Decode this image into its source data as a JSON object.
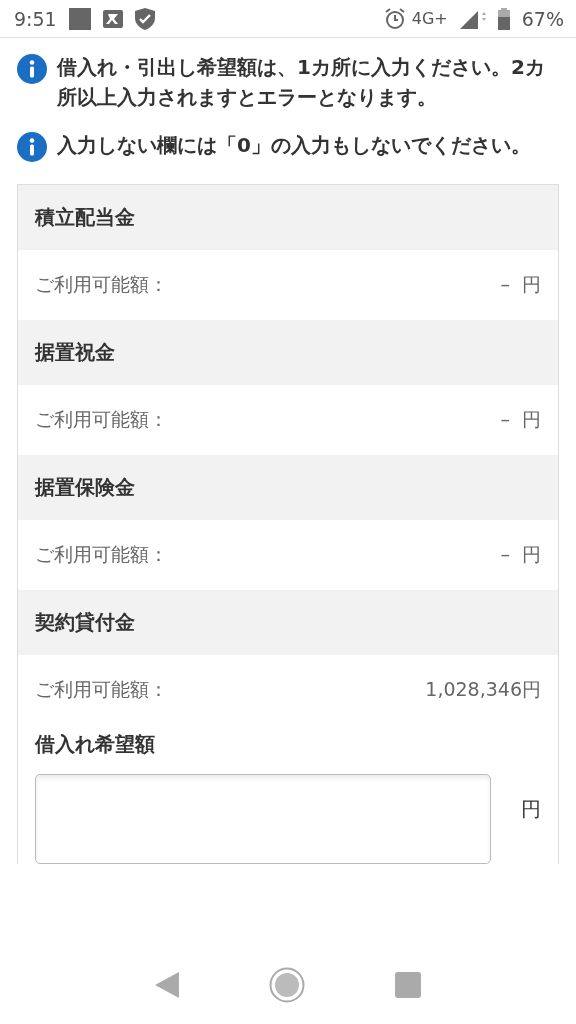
{
  "status_bar": {
    "time": "9:51",
    "network": "4G+",
    "battery": "67%"
  },
  "notes": [
    "借入れ・引出し希望額は、1カ所に入力ください。2カ所以上入力されますとエラーとなります。",
    "入力しない欄には「0」の入力もしないでください。"
  ],
  "sections": [
    {
      "title": "積立配当金",
      "label": "ご利用可能額：",
      "value": "–  円"
    },
    {
      "title": "据置祝金",
      "label": "ご利用可能額：",
      "value": "–  円"
    },
    {
      "title": "据置保険金",
      "label": "ご利用可能額：",
      "value": "–  円"
    },
    {
      "title": "契約貸付金",
      "label": "ご利用可能額：",
      "value": "1,028,346円",
      "input": {
        "label": "借入れ希望額",
        "unit": "円"
      }
    }
  ]
}
